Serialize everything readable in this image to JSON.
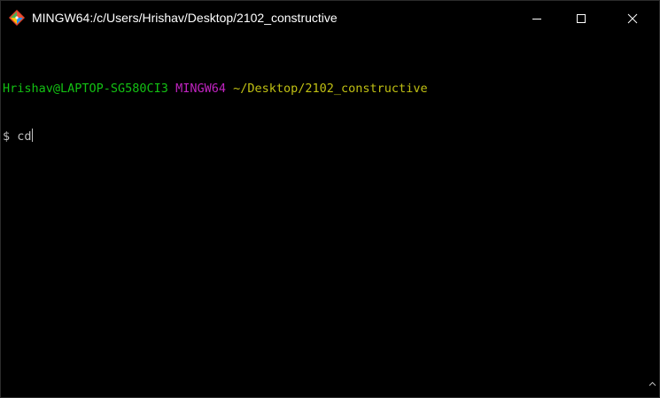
{
  "window": {
    "title": "MINGW64:/c/Users/Hrishav/Desktop/2102_constructive",
    "icon": "git-bash-icon"
  },
  "controls": {
    "minimize": "minimize-icon",
    "maximize": "maximize-icon",
    "close": "close-icon"
  },
  "terminal": {
    "prompt_user": "Hrishav@LAPTOP-SG580CI3",
    "prompt_system": "MINGW64",
    "prompt_path": "~/Desktop/2102_constructive",
    "prompt_symbol": "$",
    "input": "cd"
  },
  "colors": {
    "background": "#000000",
    "user": "#13c013",
    "system": "#c023c0",
    "path": "#c0c013",
    "text": "#c0c0c0"
  }
}
